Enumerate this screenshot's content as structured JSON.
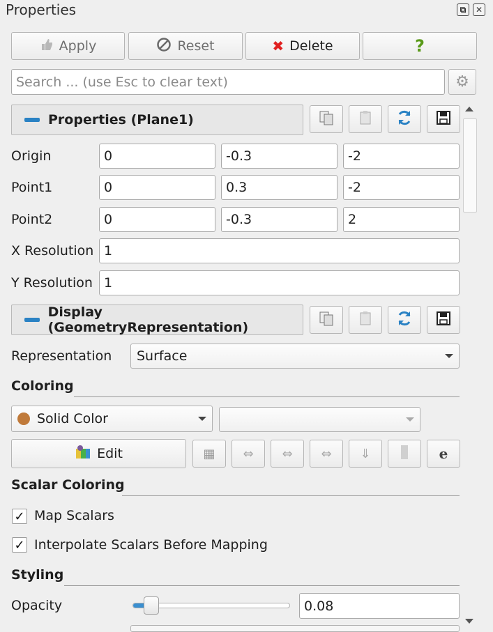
{
  "panel": {
    "title": "Properties"
  },
  "toolbar": {
    "apply": "Apply",
    "reset": "Reset",
    "delete": "Delete",
    "help": "?"
  },
  "search": {
    "placeholder": "Search ... (use Esc to clear text)"
  },
  "properties_section": {
    "title": "Properties (Plane1)",
    "origin": {
      "label": "Origin",
      "x": "0",
      "y": "-0.3",
      "z": "-2"
    },
    "point1": {
      "label": "Point1",
      "x": "0",
      "y": "0.3",
      "z": "-2"
    },
    "point2": {
      "label": "Point2",
      "x": "0",
      "y": "-0.3",
      "z": "2"
    },
    "xres": {
      "label": "X Resolution",
      "value": "1"
    },
    "yres": {
      "label": "Y Resolution",
      "value": "1"
    }
  },
  "display_section": {
    "title": "Display (GeometryRepresentation)",
    "representation": {
      "label": "Representation",
      "value": "Surface"
    },
    "coloring": {
      "label": "Coloring",
      "value": "Solid Color",
      "component": "",
      "edit": "Edit",
      "swatch": "#c07a3a"
    },
    "scalar_coloring": {
      "label": "Scalar Coloring",
      "map_scalars": "Map Scalars",
      "interpolate": "Interpolate Scalars Before Mapping",
      "map_checked": true,
      "interp_checked": true
    },
    "styling": {
      "label": "Styling",
      "opacity_label": "Opacity",
      "opacity_value": "0.08",
      "opacity_fraction": 0.08
    }
  },
  "colors": {
    "accent": "#2a82c4",
    "refresh": "#2a82c4",
    "delete_x": "#e02020",
    "help": "#5a9a1a"
  }
}
